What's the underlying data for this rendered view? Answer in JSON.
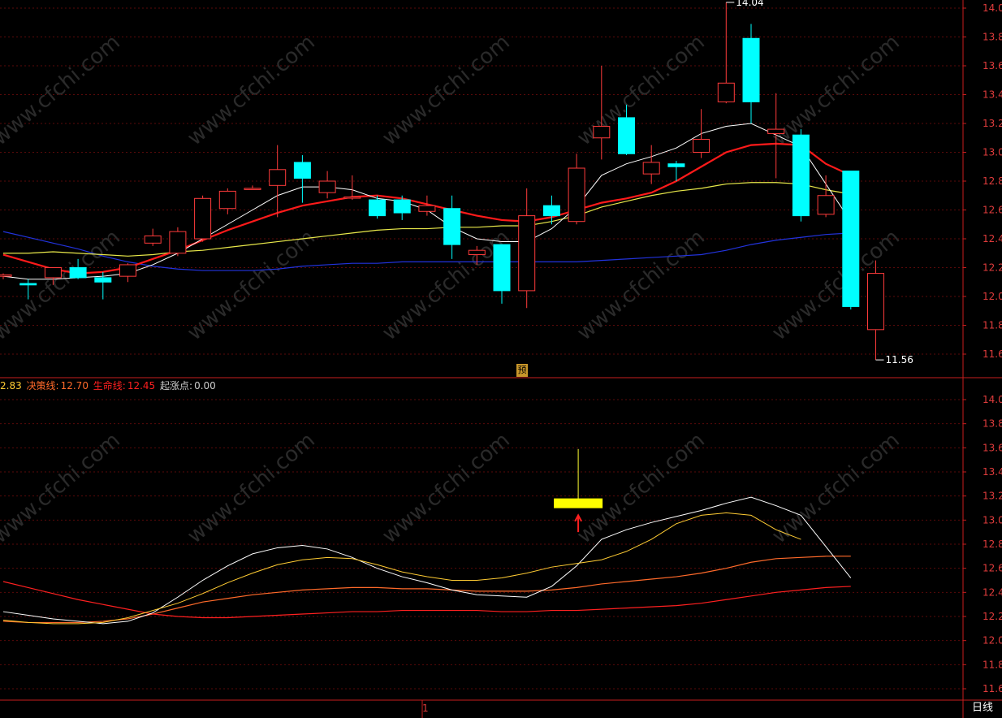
{
  "main_panel": {
    "high_annotation": "14.04",
    "low_annotation": "11.56",
    "y_ticks": [
      "14.00",
      "13.80",
      "13.60",
      "13.40",
      "13.20",
      "13.00",
      "12.80",
      "12.60",
      "12.40",
      "12.20",
      "12.00",
      "11.80",
      "11.60"
    ]
  },
  "indicator_bar": {
    "partial_value": "2.83",
    "decision_line_label": "决策线:",
    "decision_line_value": "12.70",
    "life_line_label": "生命线:",
    "life_line_value": "12.45",
    "start_point_label": "起涨点:",
    "start_point_value": "0.00"
  },
  "lower_panel": {
    "y_ticks": [
      "14.00",
      "13.80",
      "13.60",
      "13.40",
      "13.20",
      "13.00",
      "12.80",
      "12.60",
      "12.40",
      "12.20",
      "12.00",
      "11.80",
      "11.60"
    ]
  },
  "yu_badge": "预",
  "period_label": "日线",
  "bottom_marker": "1",
  "watermark_text": "www.cfchi.com",
  "colors": {
    "up": "#ff3b3b",
    "down": "#00ffff",
    "ma5": "#ffffff",
    "ma10": "#ff1a1a",
    "ma20": "#e8e84a",
    "ma60": "#2233dd",
    "axis": "#c81e1e"
  },
  "chart_data": [
    {
      "type": "candlestick",
      "ylim": [
        11.5,
        14.05
      ],
      "candles": [
        {
          "o": 12.14,
          "h": 12.16,
          "l": 12.12,
          "c": 12.15
        },
        {
          "o": 12.09,
          "h": 12.12,
          "l": 11.98,
          "c": 12.08
        },
        {
          "o": 12.13,
          "h": 12.19,
          "l": 12.08,
          "c": 12.2
        },
        {
          "o": 12.2,
          "h": 12.26,
          "l": 12.12,
          "c": 12.13
        },
        {
          "o": 12.13,
          "h": 12.17,
          "l": 11.98,
          "c": 12.1
        },
        {
          "o": 12.14,
          "h": 12.23,
          "l": 12.1,
          "c": 12.22
        },
        {
          "o": 12.37,
          "h": 12.47,
          "l": 12.35,
          "c": 12.42
        },
        {
          "o": 12.3,
          "h": 12.48,
          "l": 12.28,
          "c": 12.45
        },
        {
          "o": 12.4,
          "h": 12.7,
          "l": 12.38,
          "c": 12.68
        },
        {
          "o": 12.61,
          "h": 12.75,
          "l": 12.57,
          "c": 12.73
        },
        {
          "o": 12.75,
          "h": 12.77,
          "l": 12.75,
          "c": 12.75
        },
        {
          "o": 12.77,
          "h": 13.05,
          "l": 12.55,
          "c": 12.88
        },
        {
          "o": 12.93,
          "h": 12.98,
          "l": 12.65,
          "c": 12.82
        },
        {
          "o": 12.72,
          "h": 12.87,
          "l": 12.68,
          "c": 12.8
        },
        {
          "o": 12.69,
          "h": 12.84,
          "l": 12.67,
          "c": 12.69
        },
        {
          "o": 12.67,
          "h": 12.7,
          "l": 12.54,
          "c": 12.56
        },
        {
          "o": 12.67,
          "h": 12.7,
          "l": 12.53,
          "c": 12.58
        },
        {
          "o": 12.59,
          "h": 12.7,
          "l": 12.56,
          "c": 12.63
        },
        {
          "o": 12.61,
          "h": 12.7,
          "l": 12.26,
          "c": 12.36
        },
        {
          "o": 12.29,
          "h": 12.35,
          "l": 12.22,
          "c": 12.32
        },
        {
          "o": 12.36,
          "h": 12.36,
          "l": 11.95,
          "c": 12.04
        },
        {
          "o": 12.04,
          "h": 12.75,
          "l": 11.92,
          "c": 12.56
        },
        {
          "o": 12.63,
          "h": 12.7,
          "l": 12.5,
          "c": 12.56
        },
        {
          "o": 12.52,
          "h": 12.99,
          "l": 12.5,
          "c": 12.89
        },
        {
          "o": 13.1,
          "h": 13.6,
          "l": 12.95,
          "c": 13.18
        },
        {
          "o": 13.24,
          "h": 13.33,
          "l": 12.98,
          "c": 12.99
        },
        {
          "o": 12.85,
          "h": 13.05,
          "l": 12.78,
          "c": 12.93
        },
        {
          "o": 12.92,
          "h": 12.94,
          "l": 12.8,
          "c": 12.9
        },
        {
          "o": 13.0,
          "h": 13.3,
          "l": 12.96,
          "c": 13.09
        },
        {
          "o": 13.35,
          "h": 14.04,
          "l": 13.34,
          "c": 13.48
        },
        {
          "o": 13.79,
          "h": 13.89,
          "l": 13.2,
          "c": 13.35
        },
        {
          "o": 13.13,
          "h": 13.41,
          "l": 12.82,
          "c": 13.16
        },
        {
          "o": 13.12,
          "h": 13.16,
          "l": 12.52,
          "c": 12.56
        },
        {
          "o": 12.57,
          "h": 12.84,
          "l": 12.55,
          "c": 12.7
        },
        {
          "o": 12.87,
          "h": 12.87,
          "l": 11.91,
          "c": 11.93
        },
        {
          "o": 11.77,
          "h": 12.25,
          "l": 11.56,
          "c": 12.16
        }
      ],
      "ma5": [
        12.14,
        12.12,
        12.12,
        12.13,
        12.14,
        12.16,
        12.22,
        12.3,
        12.4,
        12.5,
        12.6,
        12.7,
        12.76,
        12.76,
        12.74,
        12.68,
        12.66,
        12.6,
        12.48,
        12.4,
        12.38,
        12.38,
        12.47,
        12.62,
        12.84,
        12.92,
        12.97,
        13.03,
        13.13,
        13.18,
        13.2,
        13.12,
        13.04,
        12.78,
        12.52
      ],
      "ma10": [
        12.29,
        12.24,
        12.19,
        12.16,
        12.17,
        12.2,
        12.26,
        12.32,
        12.39,
        12.46,
        12.52,
        12.58,
        12.63,
        12.66,
        12.69,
        12.7,
        12.68,
        12.64,
        12.6,
        12.56,
        12.53,
        12.52,
        12.55,
        12.6,
        12.65,
        12.68,
        12.72,
        12.8,
        12.9,
        13.0,
        13.05,
        13.06,
        13.05,
        12.92,
        12.84
      ],
      "ma20": [
        12.3,
        12.3,
        12.31,
        12.3,
        12.29,
        12.28,
        12.29,
        12.31,
        12.32,
        12.34,
        12.36,
        12.38,
        12.4,
        12.42,
        12.44,
        12.46,
        12.47,
        12.47,
        12.48,
        12.48,
        12.49,
        12.49,
        12.52,
        12.56,
        12.62,
        12.66,
        12.7,
        12.73,
        12.75,
        12.78,
        12.79,
        12.79,
        12.78,
        12.74,
        12.71
      ],
      "ma60": [
        12.45,
        12.41,
        12.37,
        12.33,
        12.28,
        12.24,
        12.21,
        12.19,
        12.18,
        12.18,
        12.18,
        12.19,
        12.21,
        12.22,
        12.23,
        12.23,
        12.24,
        12.24,
        12.24,
        12.24,
        12.24,
        12.24,
        12.24,
        12.24,
        12.25,
        12.26,
        12.27,
        12.28,
        12.29,
        12.32,
        12.36,
        12.39,
        12.41,
        12.43,
        12.44
      ]
    },
    {
      "type": "line",
      "ylim": [
        11.5,
        14.05
      ],
      "series": [
        {
          "name": "决策线",
          "color": "#ff6a2a",
          "values": [
            12.16,
            12.15,
            12.15,
            12.15,
            12.16,
            12.18,
            12.22,
            12.27,
            12.32,
            12.35,
            12.38,
            12.4,
            12.42,
            12.43,
            12.44,
            12.44,
            12.43,
            12.43,
            12.42,
            12.41,
            12.41,
            12.41,
            12.42,
            12.44,
            12.47,
            12.49,
            12.51,
            12.53,
            12.56,
            12.6,
            12.65,
            12.68,
            12.69,
            12.7,
            12.7
          ]
        },
        {
          "name": "生命线",
          "color": "#ff2020",
          "values": [
            12.49,
            12.44,
            12.39,
            12.34,
            12.3,
            12.26,
            12.22,
            12.2,
            12.19,
            12.19,
            12.2,
            12.21,
            12.22,
            12.23,
            12.24,
            12.24,
            12.25,
            12.25,
            12.25,
            12.25,
            12.24,
            12.24,
            12.25,
            12.25,
            12.26,
            12.27,
            12.28,
            12.29,
            12.31,
            12.34,
            12.37,
            12.4,
            12.42,
            12.44,
            12.45
          ]
        }
      ],
      "extra_lines": [
        {
          "color": "#ffffff",
          "values": [
            12.24,
            12.21,
            12.18,
            12.16,
            12.14,
            12.16,
            12.23,
            12.36,
            12.5,
            12.62,
            12.72,
            12.77,
            12.79,
            12.76,
            12.69,
            12.6,
            12.53,
            12.48,
            12.42,
            12.38,
            12.37,
            12.36,
            12.45,
            12.62,
            12.84,
            12.92,
            12.98,
            13.03,
            13.08,
            13.14,
            13.19,
            13.12,
            13.04,
            12.78,
            12.52
          ]
        },
        {
          "color": "#ffcc33",
          "values": [
            12.17,
            12.15,
            12.14,
            12.14,
            12.15,
            12.19,
            12.25,
            12.31,
            12.39,
            12.48,
            12.56,
            12.63,
            12.67,
            12.69,
            12.68,
            12.63,
            12.57,
            12.53,
            12.5,
            12.5,
            12.52,
            12.56,
            12.61,
            12.64,
            12.67,
            12.74,
            12.84,
            12.97,
            13.04,
            13.06,
            13.04,
            12.92,
            12.84
          ]
        }
      ],
      "marker": {
        "index": 23,
        "high": 13.59,
        "low": 13.13,
        "bar_value": 13.14
      }
    }
  ]
}
